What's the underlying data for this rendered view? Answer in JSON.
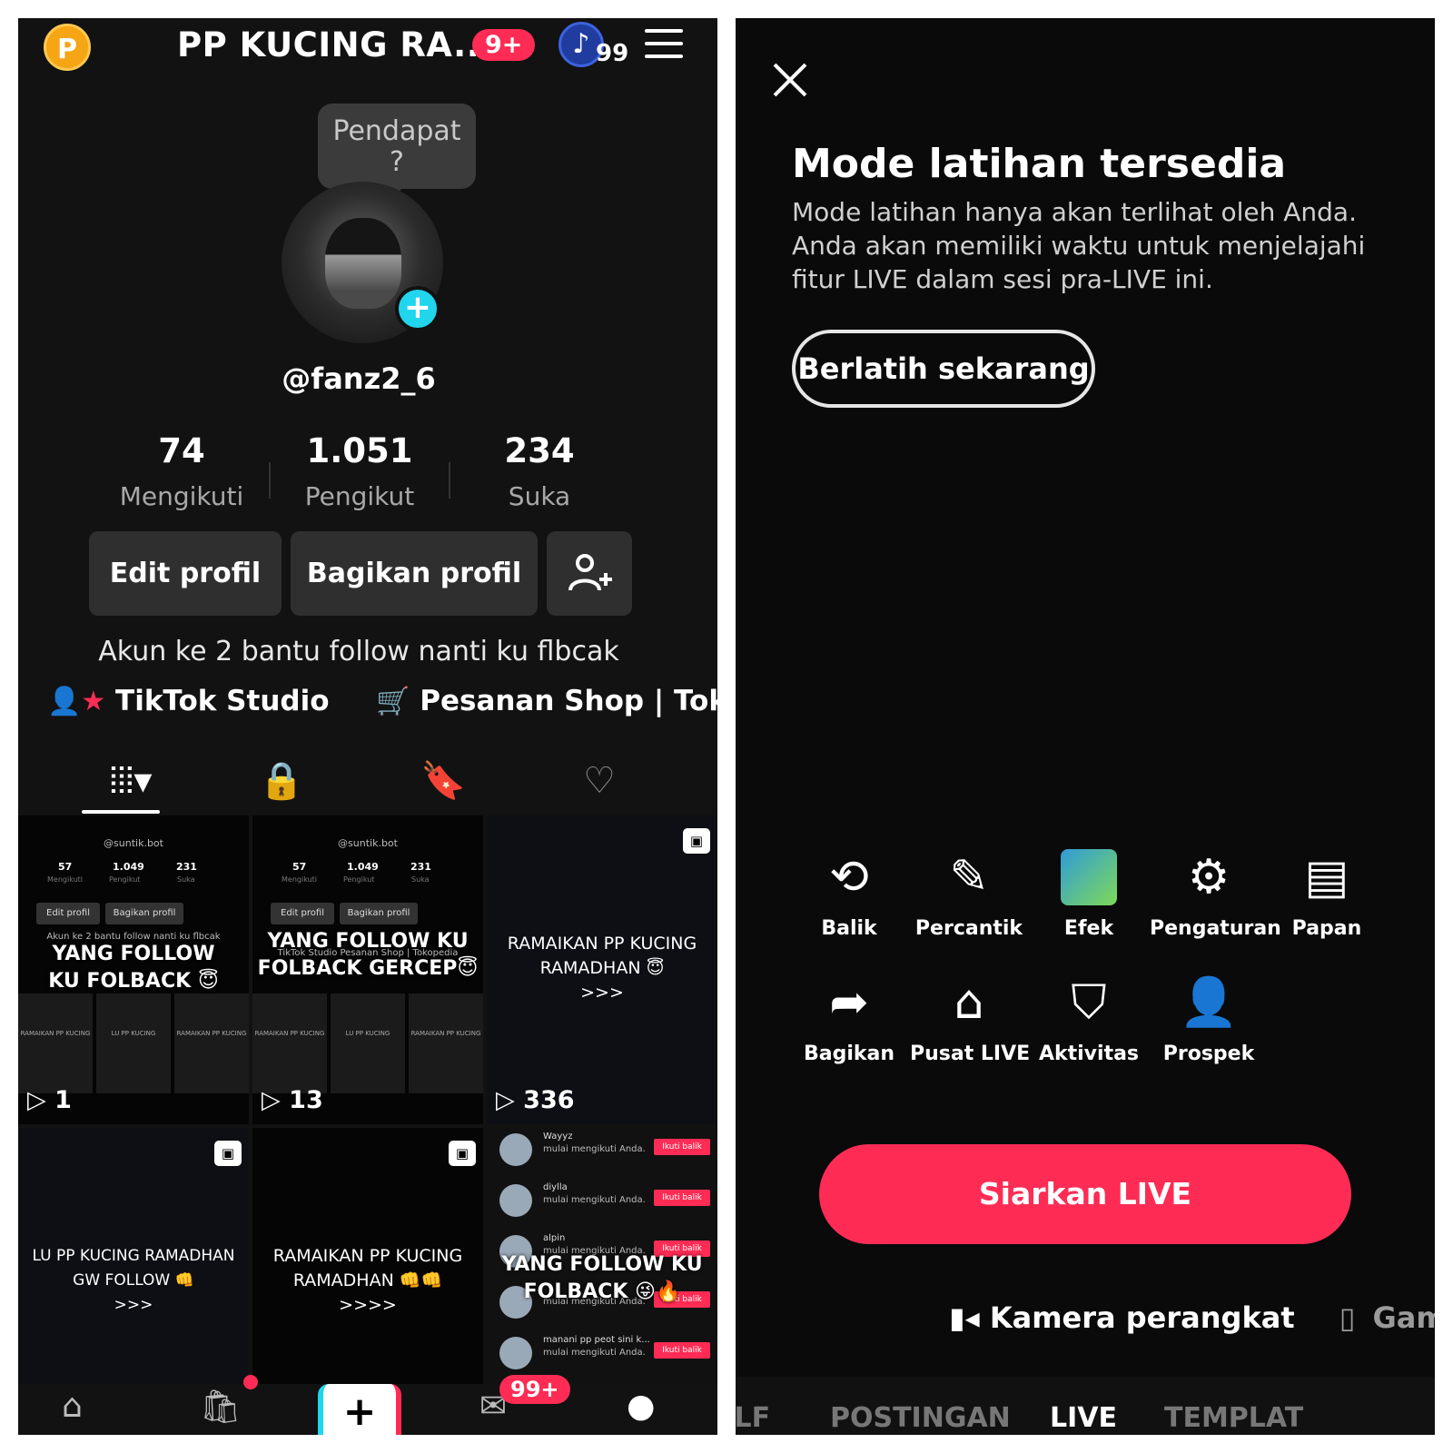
{
  "profile": {
    "points_badge": "P",
    "title": "PP KUCING RA...",
    "notif_count": "9+",
    "coin_count": "99",
    "bubble": "Pendapat\n?",
    "handle": "@fanz2_6",
    "stats": [
      {
        "value": "74",
        "label": "Mengikuti"
      },
      {
        "value": "1.051",
        "label": "Pengikut"
      },
      {
        "value": "234",
        "label": "Suka"
      }
    ],
    "edit_label": "Edit profil",
    "share_label": "Bagikan profil",
    "bio": "Akun ke 2 bantu follow nanti ku flbcak",
    "link_studio": "TikTok Studio",
    "link_shop": "Pesanan Shop | Tokopedia",
    "inbox_count": "99+"
  },
  "videos": [
    {
      "mini_handle": "@suntik.bot",
      "mini_stats": [
        "57",
        "1.049",
        "231"
      ],
      "mini_labels": [
        "Mengikuti",
        "Pengikut",
        "Suka"
      ],
      "mini_edit": "Edit profil",
      "mini_share": "Bagikan profil",
      "mini_bio": "Akun ke 2 bantu follow nanti ku flbcak",
      "title": "YANG FOLLOW\nKU FOLBACK 😇",
      "views": "1"
    },
    {
      "mini_handle": "@suntik.bot",
      "mini_stats": [
        "57",
        "1.049",
        "231"
      ],
      "mini_labels": [
        "Mengikuti",
        "Pengikut",
        "Suka"
      ],
      "mini_edit": "Edit profil",
      "mini_share": "Bagikan profil",
      "mini_bio": "TikTok Studio  Pesanan Shop | Tokopedia",
      "title": "YANG FOLLOW KU\nFOLBACK GERCEP😇",
      "views": "13"
    },
    {
      "caption": "RAMAIKAN PP KUCING\nRAMADHAN 😇\n>>>",
      "views": "336"
    },
    {
      "caption": "LU PP KUCING RAMADHAN\nGW FOLLOW 👊\n>>>"
    },
    {
      "caption": "RAMAIKAN PP KUCING\nRAMADHAN 👊👊\n>>>>"
    },
    {
      "title": "YANG FOLLOW KU\nFOLBACK 😜🔥",
      "notifs": [
        {
          "name": "Wayyz",
          "msg": "mulai mengikuti Anda.",
          "btn": "Ikuti balik"
        },
        {
          "name": "diylla",
          "msg": "mulai mengikuti Anda.",
          "btn": "Ikuti balik"
        },
        {
          "name": "alpin",
          "msg": "mulai mengikuti Anda.",
          "btn": "Ikuti balik"
        },
        {
          "name": "",
          "msg": "mulai mengikuti Anda.",
          "btn": "Ikuti balik"
        },
        {
          "name": "manani pp peot sini k...",
          "msg": "mulai mengikuti Anda.",
          "btn": "Ikuti balik"
        }
      ]
    }
  ],
  "live": {
    "title": "Mode latihan tersedia",
    "description": "Mode latihan hanya akan terlihat oleh Anda. Anda akan memiliki waktu untuk menjelajahi fitur LIVE dalam sesi pra-LIVE ini.",
    "practice_button": "Berlatih sekarang",
    "tools": [
      {
        "label": "Balik",
        "icon": "flip-camera-icon"
      },
      {
        "label": "Percantik",
        "icon": "magic-wand-icon"
      },
      {
        "label": "Efek",
        "icon": "effects-icon"
      },
      {
        "label": "Pengaturan",
        "icon": "gear-icon"
      },
      {
        "label": "Papan",
        "icon": "board-icon"
      },
      {
        "label": "Bagikan",
        "icon": "share-icon"
      },
      {
        "label": "Pusat LIVE",
        "icon": "live-center-icon"
      },
      {
        "label": "Aktivitas",
        "icon": "activity-shield-icon"
      },
      {
        "label": "Prospek",
        "icon": "prospect-icon"
      }
    ],
    "go_live": "Siarkan LIVE",
    "source_camera": "Kamera perangkat",
    "source_game": "Game se",
    "modes": [
      "ELF",
      "POSTINGAN",
      "LIVE",
      "TEMPLAT"
    ]
  },
  "colors": {
    "accent": "#fe2c55",
    "cyan": "#20d5ec",
    "background": "#121212"
  }
}
